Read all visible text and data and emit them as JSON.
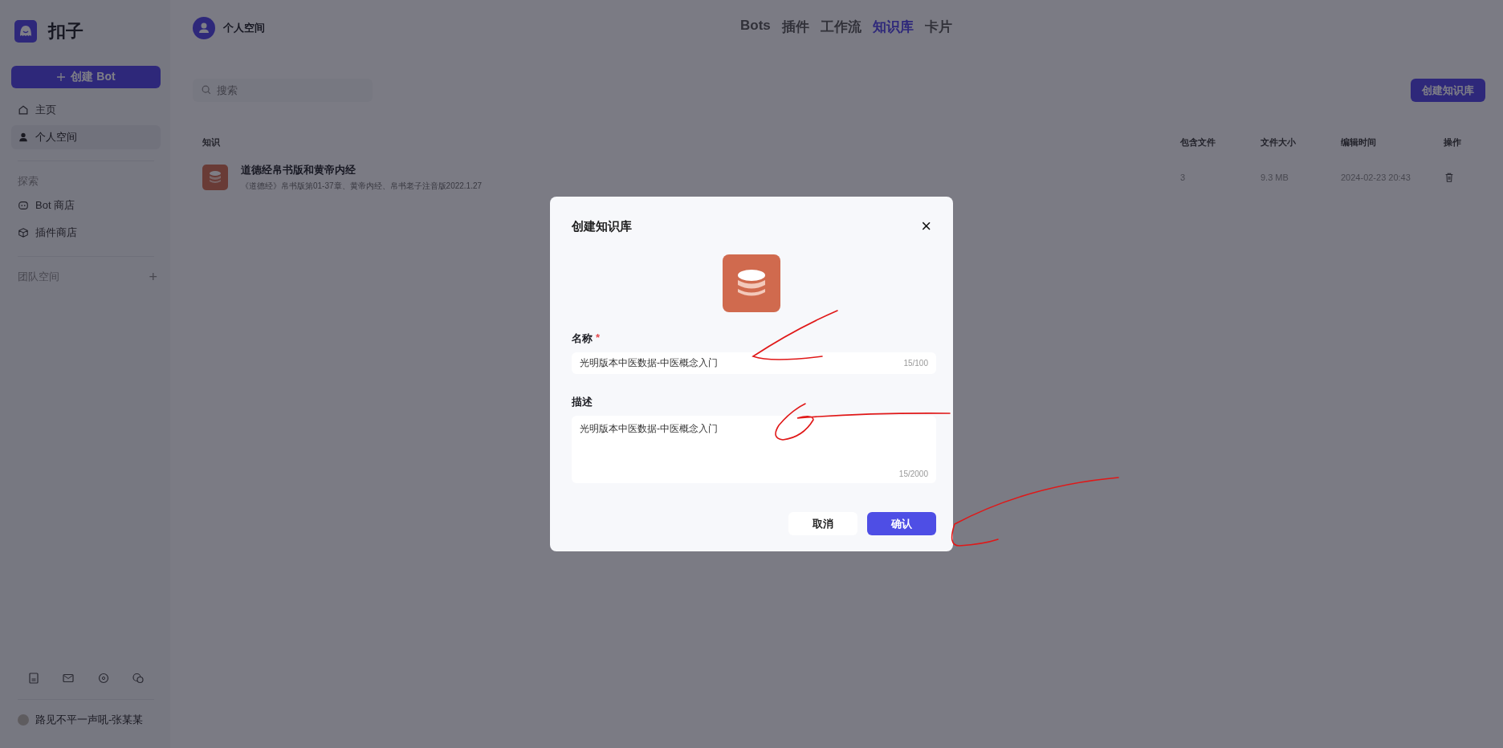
{
  "sidebar": {
    "app_name": "扣子",
    "create_button": "创建 Bot",
    "nav": [
      {
        "label": "主页",
        "selected": false
      },
      {
        "label": "个人空间",
        "selected": true
      }
    ],
    "explore_heading": "探索",
    "explore": [
      {
        "label": "Bot 商店"
      },
      {
        "label": "插件商店"
      }
    ],
    "team_heading": "团队空间",
    "team_add": "+",
    "user_name": "路见不平一声吼-张某某"
  },
  "header": {
    "space_name": "个人空间",
    "tabs": [
      {
        "label": "Bots",
        "selected": false
      },
      {
        "label": "插件",
        "selected": false
      },
      {
        "label": "工作流",
        "selected": false
      },
      {
        "label": "知识库",
        "selected": true
      },
      {
        "label": "卡片",
        "selected": false
      }
    ]
  },
  "search": {
    "placeholder": "搜索"
  },
  "create_knowledge_button": "创建知识库",
  "table": {
    "columns": [
      "知识",
      "包含文件",
      "文件大小",
      "编辑时间",
      "操作"
    ],
    "rows": [
      {
        "name": "道德经帛书版和黄帝内经",
        "description": "《道德经》帛书版第01-37章、黄帝内经、帛书老子注音版2022.1.27",
        "files": "3",
        "size": "9.3 MB",
        "edited": "2024-02-23 20:43"
      }
    ]
  },
  "dialog": {
    "title": "创建知识库",
    "close": "×",
    "name_label": "名称",
    "required_mark": "*",
    "name_value": "光明版本中医数据-中医概念入门",
    "name_counter": "15/100",
    "desc_label": "描述",
    "desc_value": "光明版本中医数据-中医概念入门",
    "desc_counter": "15/2000",
    "cancel": "取消",
    "confirm": "确认"
  }
}
